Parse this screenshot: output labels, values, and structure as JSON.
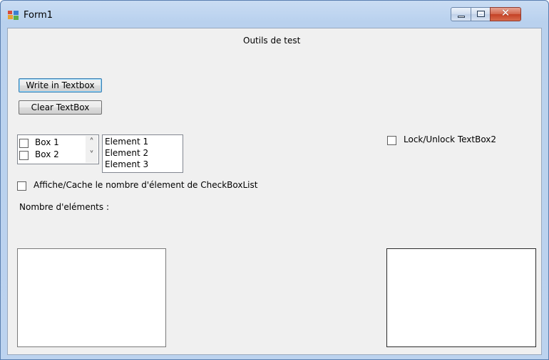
{
  "window": {
    "title": "Form1",
    "minimize": "–",
    "maximize": "□",
    "close": "✕"
  },
  "form": {
    "header_label": "Outils de test",
    "write_button": "Write in Textbox",
    "clear_button": "Clear TextBox",
    "checked_list": {
      "items": [
        {
          "label": "Box 1",
          "checked": false
        },
        {
          "label": "Box 2",
          "checked": false
        }
      ],
      "scroll_up": "˄",
      "scroll_down": "˅"
    },
    "listbox": {
      "items": [
        "Element 1",
        "Element 2",
        "Element 3"
      ]
    },
    "show_count_checkbox": {
      "label": "Affiche/Cache le nombre d'élement de CheckBoxList",
      "checked": false
    },
    "count_label": "Nombre d'eléments :",
    "lock_checkbox": {
      "label": "Lock/Unlock TextBox2",
      "checked": false
    },
    "textbox1": {
      "value": ""
    },
    "textbox2": {
      "value": ""
    }
  }
}
